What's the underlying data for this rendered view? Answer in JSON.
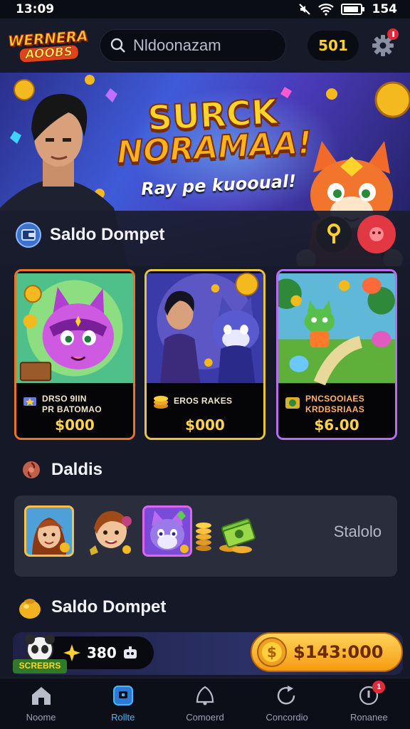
{
  "status_bar": {
    "time": "13:09",
    "battery": "154"
  },
  "header": {
    "logo_line1": "WERNERA",
    "logo_line2": "AOOBS",
    "search_placeholder": "Nldoonazam",
    "coins": "501"
  },
  "hero": {
    "title_line1": "SURCK",
    "title_line2": "NORAMAA!",
    "subtitle": "Ray pe kuooual!"
  },
  "wallet_section": {
    "title": "Saldo Dompet"
  },
  "cards": [
    {
      "caption_line1": "DRSO 9IIN",
      "caption_line2": "PR BATOMAO",
      "price": "$000",
      "border": "#e8742a"
    },
    {
      "caption_line1": "EROS RAKES",
      "caption_line2": "",
      "price": "$000",
      "border": "#e7c43a"
    },
    {
      "caption_line1": "PNCSOOIAES",
      "caption_line2": "KRDBSRIAAS",
      "price": "$6.00",
      "border": "#b86cf0"
    }
  ],
  "items_section": {
    "title": "Daldis",
    "status_text": "Stalolo"
  },
  "balance_section": {
    "title": "Saldo Dompet",
    "badge_label": "SCREBRS",
    "points": "380",
    "amount": "$143:000"
  },
  "nav": [
    {
      "label": "Noome",
      "icon": "home-icon"
    },
    {
      "label": "Rollte",
      "icon": "wallet-icon"
    },
    {
      "label": "Comoerd",
      "icon": "bell-icon"
    },
    {
      "label": "Concordio",
      "icon": "refresh-icon"
    },
    {
      "label": "Ronanee",
      "icon": "info-icon",
      "badge": "1"
    }
  ]
}
